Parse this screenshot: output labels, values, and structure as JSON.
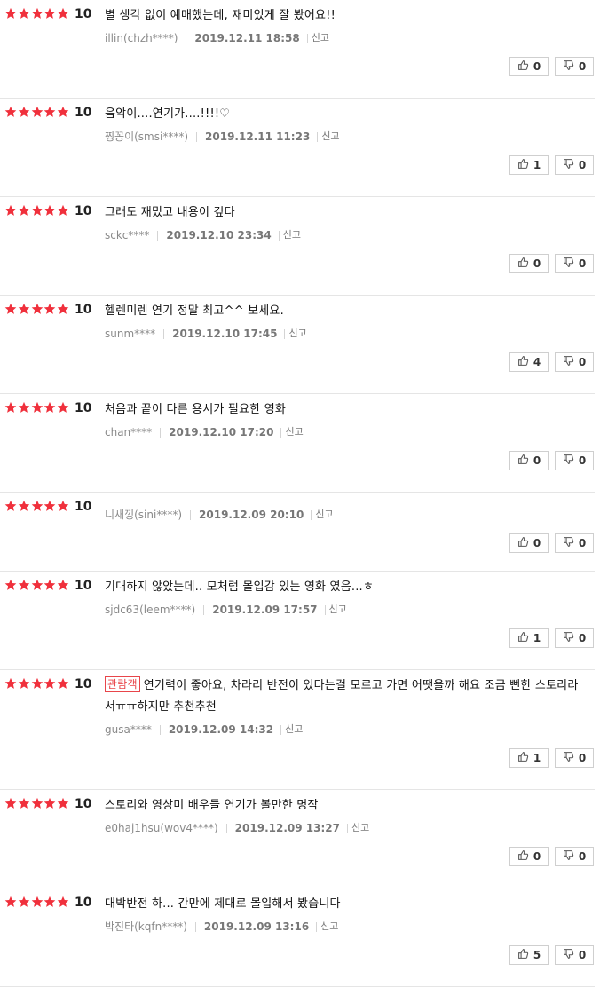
{
  "colors": {
    "star": "#f0303c",
    "badge": "#e8454a",
    "divider": "#e5e5e5"
  },
  "icons": {
    "star": "star-icon",
    "like": "thumbs-up-icon",
    "dislike": "thumbs-down-icon"
  },
  "report_label": "신고",
  "reviews": [
    {
      "stars": 5,
      "score": "10",
      "badge": "",
      "text": "별 생각 없이 예매했는데, 재미있게 잘 봤어요!!",
      "user": "illin(chzh****)",
      "date": "2019.12.11 18:58",
      "likes": "0",
      "dislikes": "0"
    },
    {
      "stars": 5,
      "score": "10",
      "badge": "",
      "text": "음악이....연기가....!!!!♡",
      "user": "찡꽁이(smsi****)",
      "date": "2019.12.11 11:23",
      "likes": "1",
      "dislikes": "0"
    },
    {
      "stars": 5,
      "score": "10",
      "badge": "",
      "text": "그래도 재밌고 내용이 깊다",
      "user": "sckc****",
      "date": "2019.12.10 23:34",
      "likes": "0",
      "dislikes": "0"
    },
    {
      "stars": 5,
      "score": "10",
      "badge": "",
      "text": "헬렌미렌 연기 정말 최고^^ 보세요.",
      "user": "sunm****",
      "date": "2019.12.10 17:45",
      "likes": "4",
      "dislikes": "0"
    },
    {
      "stars": 5,
      "score": "10",
      "badge": "",
      "text": "처음과 끝이 다른 용서가 필요한 영화",
      "user": "chan****",
      "date": "2019.12.10 17:20",
      "likes": "0",
      "dislikes": "0"
    },
    {
      "stars": 5,
      "score": "10",
      "badge": "",
      "text": "",
      "user": "니새낑(sini****)",
      "date": "2019.12.09 20:10",
      "likes": "0",
      "dislikes": "0"
    },
    {
      "stars": 5,
      "score": "10",
      "badge": "",
      "text": "기대하지 않았는데.. 모처럼 몰입감 있는 영화 였음...ㅎ",
      "user": "sjdc63(leem****)",
      "date": "2019.12.09 17:57",
      "likes": "1",
      "dislikes": "0"
    },
    {
      "stars": 5,
      "score": "10",
      "badge": "관람객",
      "text": "연기력이 좋아요, 차라리 반전이 있다는걸 모르고 가면 어땟을까 해요 조금 뻔한 스토리라서ㅠㅠ하지만 추천추천",
      "user": "gusa****",
      "date": "2019.12.09 14:32",
      "likes": "1",
      "dislikes": "0"
    },
    {
      "stars": 5,
      "score": "10",
      "badge": "",
      "text": "스토리와 영상미 배우들 연기가 볼만한 명작",
      "user": "e0haj1hsu(wov4****)",
      "date": "2019.12.09 13:27",
      "likes": "0",
      "dislikes": "0"
    },
    {
      "stars": 5,
      "score": "10",
      "badge": "",
      "text": "대박반전 하... 간만에 제대로 몰입해서 봤습니다",
      "user": "박진타(kqfn****)",
      "date": "2019.12.09 13:16",
      "likes": "5",
      "dislikes": "0"
    }
  ]
}
